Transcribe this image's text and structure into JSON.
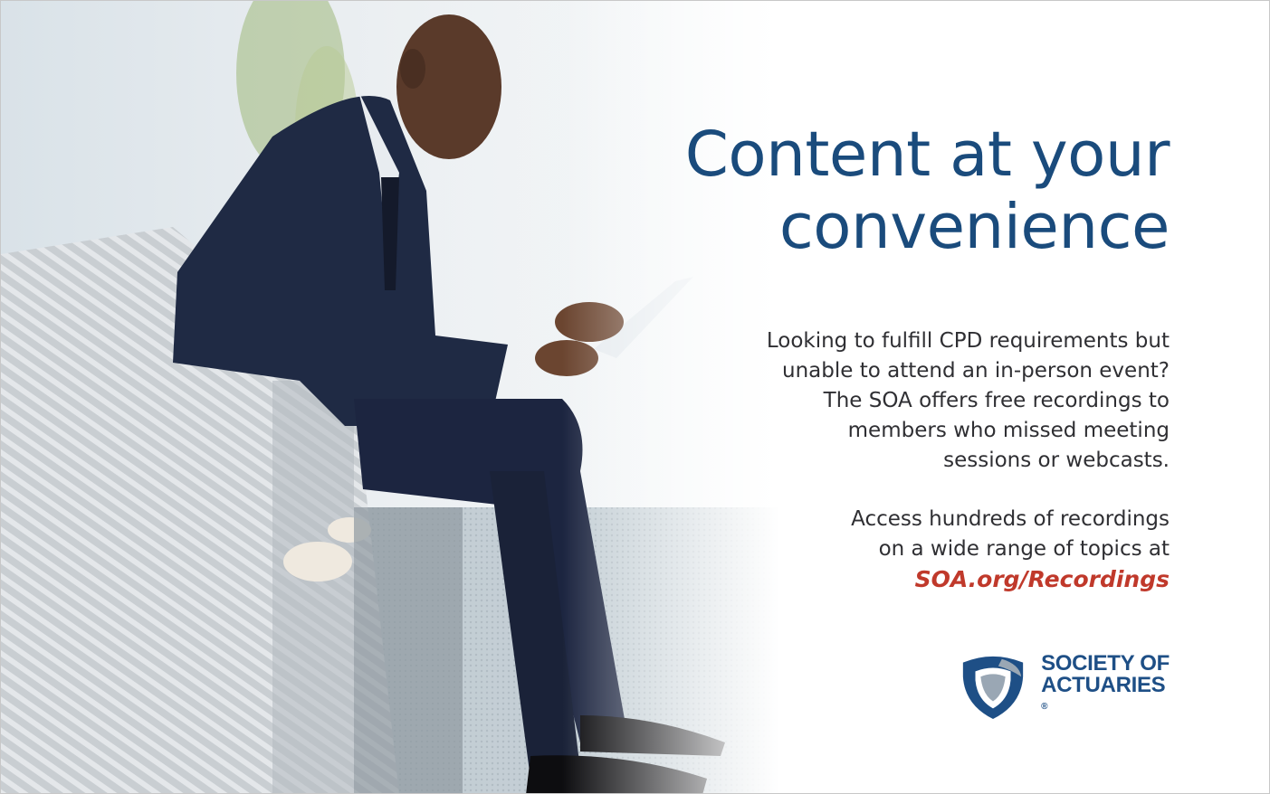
{
  "headline": {
    "line1": "Content at your",
    "line2": "convenience"
  },
  "body": {
    "paragraph1": [
      "Looking to fulfill CPD requirements but",
      "unable to attend an in-person event?",
      "The SOA offers free recordings to",
      "members who missed meeting",
      "sessions or webcasts."
    ],
    "paragraph2": [
      "Access hundreds of recordings",
      "on a wide range of topics at"
    ],
    "url": "SOA.org/Recordings"
  },
  "logo": {
    "line1": "SOCIETY OF",
    "line2": "ACTUARIES",
    "registered_mark": "®",
    "icon": "shield-icon"
  },
  "colors": {
    "headline": "#1a4b7c",
    "url": "#c0392b",
    "logo_blue": "#1e4f86",
    "logo_gray": "#9aa7b4"
  }
}
